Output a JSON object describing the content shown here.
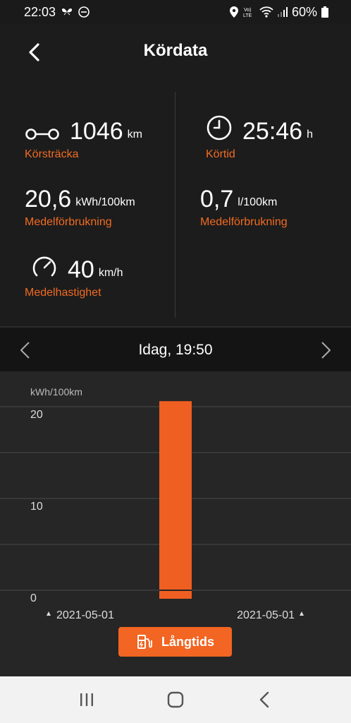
{
  "status_bar": {
    "time": "22:03",
    "battery_percent": "60%",
    "icons": [
      "butterfly-icon",
      "do-not-disturb-icon",
      "location-icon",
      "volte-icon",
      "wifi-icon",
      "signal-icon",
      "battery-icon"
    ]
  },
  "header": {
    "title": "Kördata",
    "back_icon": "back-arrow-icon"
  },
  "stats": {
    "distance": {
      "value": "1046",
      "unit": "km",
      "label": "Körsträcka",
      "icon": "route-icon"
    },
    "drive_time": {
      "value": "25:46",
      "unit": "h",
      "label": "Körtid",
      "icon": "clock-icon"
    },
    "electric_consumption": {
      "value": "20,6",
      "unit": "kWh/100km",
      "label": "Medelförbrukning"
    },
    "fuel_consumption": {
      "value": "0,7",
      "unit": "l/100km",
      "label": "Medelförbrukning"
    },
    "speed": {
      "value": "40",
      "unit": "km/h",
      "label": "Medelhastighet",
      "icon": "speedometer-icon"
    }
  },
  "date_nav": {
    "label": "Idag, 19:50",
    "prev_icon": "chevron-left-icon",
    "next_icon": "chevron-right-icon"
  },
  "chart_data": {
    "type": "bar",
    "ylabel": "kWh/100km",
    "ylim": [
      0,
      20.6
    ],
    "yticks": [
      "0",
      "10",
      "20"
    ],
    "ytick_values": [
      0,
      10,
      20
    ],
    "categories": [
      ""
    ],
    "values": [
      20.6
    ],
    "x_start_label": "2021-05-01",
    "x_end_label": "2021-05-01",
    "bar_color": "#f05f22",
    "grid": true
  },
  "mode_button": {
    "label": "Långtids",
    "icon": "fuel-charge-icon"
  },
  "nav_bar": {
    "icons": [
      "recent-apps-icon",
      "home-icon",
      "back-icon"
    ]
  },
  "colors": {
    "accent": "#f26522",
    "background": "#1c1c1c",
    "chart_bg": "#262626"
  }
}
